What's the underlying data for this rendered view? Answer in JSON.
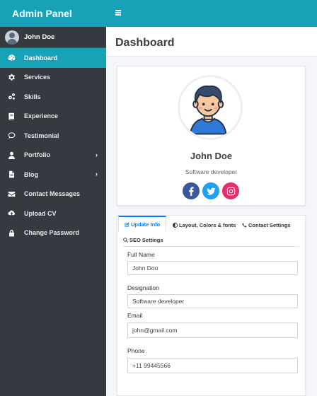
{
  "app": {
    "title": "Admin Panel"
  },
  "user": {
    "name": "John Doe"
  },
  "sidebar": {
    "items": [
      {
        "label": "Dashboard",
        "icon": "dashboard-icon",
        "active": true
      },
      {
        "label": "Services",
        "icon": "gear-icon"
      },
      {
        "label": "Skills",
        "icon": "gears-icon"
      },
      {
        "label": "Experience",
        "icon": "book-icon"
      },
      {
        "label": "Testimonial",
        "icon": "comment-icon"
      },
      {
        "label": "Portfolio",
        "icon": "user-icon",
        "submenu": true
      },
      {
        "label": "Blog",
        "icon": "file-icon",
        "submenu": true
      },
      {
        "label": "Contact Messages",
        "icon": "envelope-icon"
      },
      {
        "label": "Upload CV",
        "icon": "cloud-upload-icon"
      },
      {
        "label": "Change Password",
        "icon": "lock-icon"
      }
    ],
    "chevron": "›"
  },
  "page": {
    "title": "Dashboard"
  },
  "profile": {
    "name": "John Doe",
    "role": "Software developer",
    "socials": [
      "facebook",
      "twitter",
      "instagram"
    ]
  },
  "tabs": [
    {
      "label": "Update Info",
      "icon": "edit-icon",
      "active": true
    },
    {
      "label": "Layout, Colors & fonts",
      "icon": "adjust-icon"
    },
    {
      "label": "Contact Settings",
      "icon": "phone-icon"
    },
    {
      "label": "SEO Settings",
      "icon": "search-icon"
    }
  ],
  "form": {
    "full_name": {
      "label": "Full Name",
      "value": "John Doo"
    },
    "designation": {
      "label": "Designation",
      "value": "Software developer"
    },
    "email": {
      "label": "Email",
      "value": "john@gmail.com"
    },
    "phone": {
      "label": "Phone",
      "value": "+11 99445566"
    }
  },
  "colors": {
    "accent": "#17a2b8",
    "sidebar": "#343a40",
    "link": "#007bff"
  }
}
